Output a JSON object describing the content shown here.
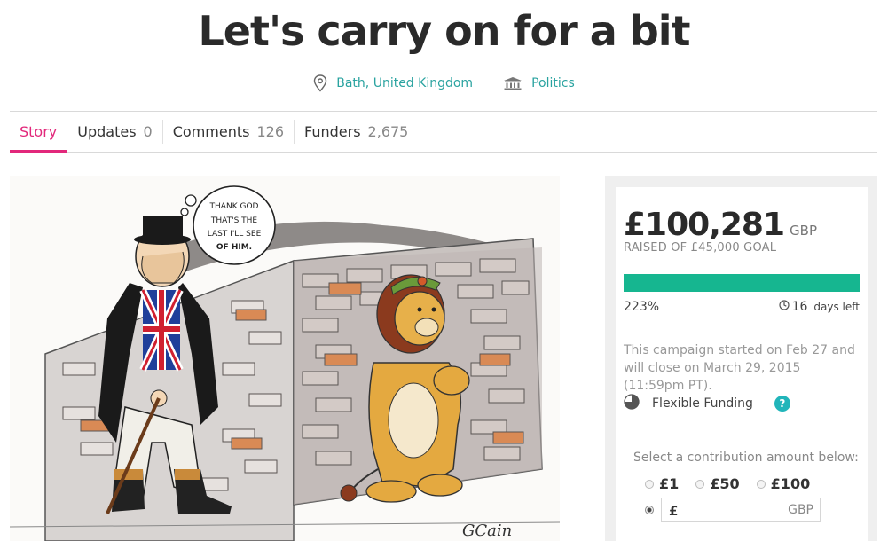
{
  "campaign": {
    "title": "Let's carry on for a bit",
    "location": "Bath, United Kingdom",
    "category": "Politics"
  },
  "tabs": [
    {
      "label": "Story",
      "count": ""
    },
    {
      "label": "Updates",
      "count": "0"
    },
    {
      "label": "Comments",
      "count": "126"
    },
    {
      "label": "Funders",
      "count": "2,675"
    }
  ],
  "image": {
    "thought_bubble": [
      "THANK GOD",
      "THAT'S THE",
      "LAST I'LL SEE",
      "OF HIM."
    ],
    "signature": "GCain"
  },
  "funding": {
    "amount": "£100,281",
    "currency": "GBP",
    "raised_label": "RAISED OF £45,000 GOAL",
    "progress_fraction": 1.0,
    "percent": "223%",
    "days_left": "16",
    "days_left_label": "days left",
    "description": "This campaign started on Feb 27 and will close on March 29, 2015 (11:59pm PT).",
    "funding_type": "Flexible Funding",
    "help_icon_glyph": "?"
  },
  "contribution": {
    "prompt": "Select a contribution amount below:",
    "options": [
      "£1",
      "£50",
      "£100"
    ],
    "custom_prefix": "£",
    "custom_currency": "GBP"
  },
  "colors": {
    "accent_pink": "#e2287b",
    "link_teal": "#2aa3a0",
    "progress_green": "#16b690",
    "help_blue": "#21b5ba"
  }
}
